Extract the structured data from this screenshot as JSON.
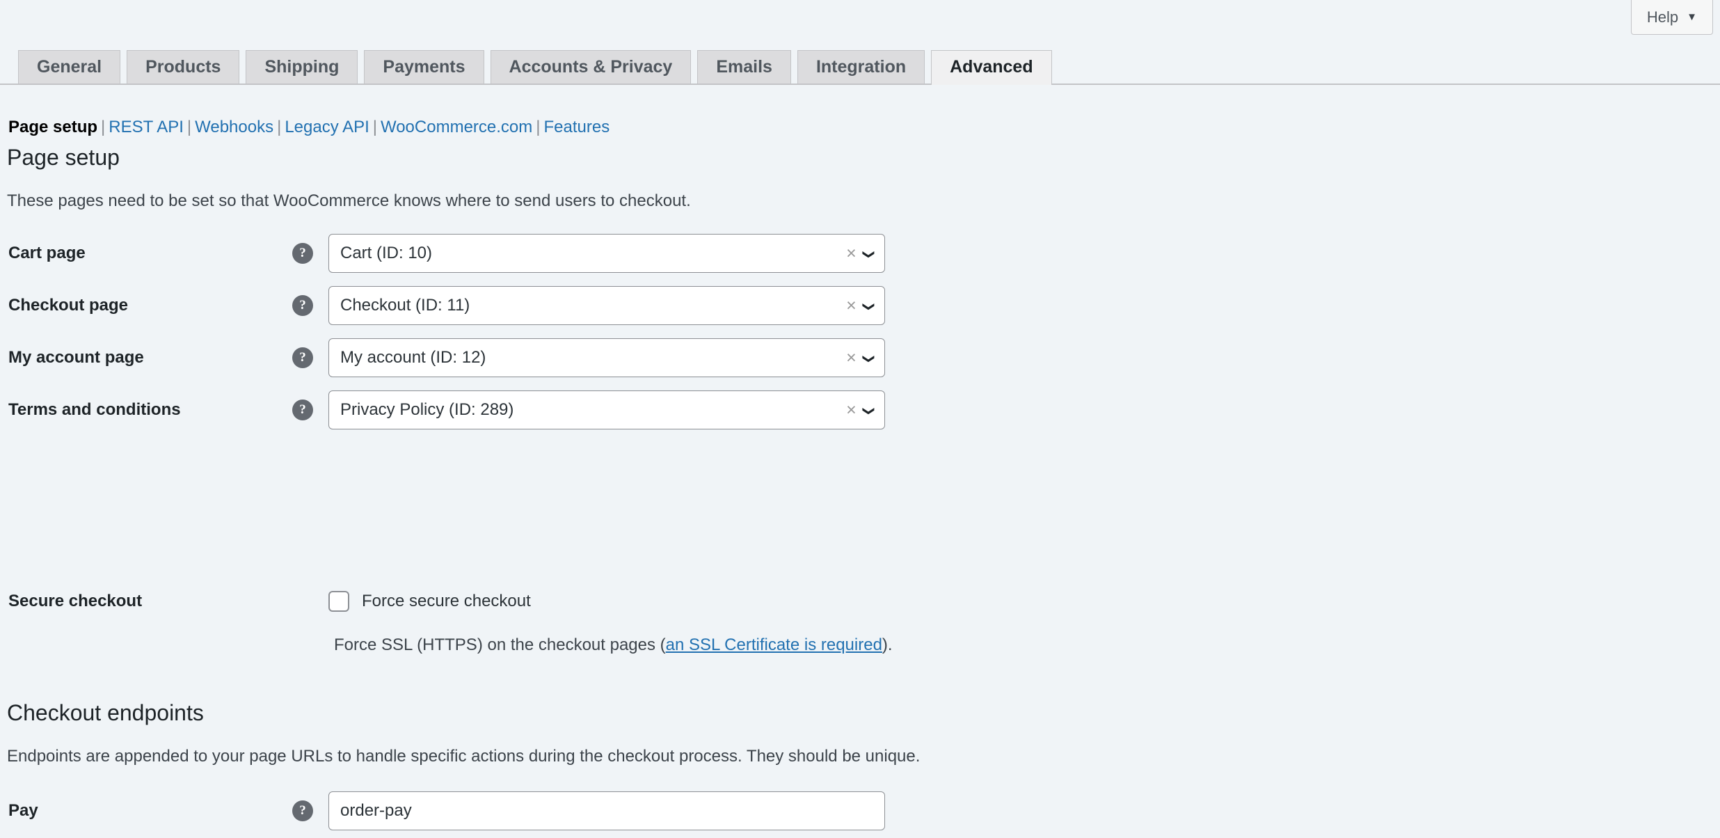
{
  "help": {
    "label": "Help",
    "caret": "chevron-down-icon"
  },
  "tabs": [
    {
      "label": "General",
      "active": false
    },
    {
      "label": "Products",
      "active": false
    },
    {
      "label": "Shipping",
      "active": false
    },
    {
      "label": "Payments",
      "active": false
    },
    {
      "label": "Accounts & Privacy",
      "active": false
    },
    {
      "label": "Emails",
      "active": false
    },
    {
      "label": "Integration",
      "active": false
    },
    {
      "label": "Advanced",
      "active": true
    }
  ],
  "subnav": {
    "current": "Page setup",
    "links": [
      "REST API",
      "Webhooks",
      "Legacy API",
      "WooCommerce.com",
      "Features"
    ],
    "separator": "|"
  },
  "page_setup": {
    "title": "Page setup",
    "description": "These pages need to be set so that WooCommerce knows where to send users to checkout.",
    "rows": [
      {
        "label": "Cart page",
        "value": "Cart (ID: 10)",
        "help": "?",
        "clear": "×",
        "caret": "⌄"
      },
      {
        "label": "Checkout page",
        "value": "Checkout (ID: 11)",
        "help": "?",
        "clear": "×",
        "caret": "⌄"
      },
      {
        "label": "My account page",
        "value": "My account (ID: 12)",
        "help": "?",
        "clear": "×",
        "caret": "⌄"
      },
      {
        "label": "Terms and conditions",
        "value": "Privacy Policy (ID: 289)",
        "help": "?",
        "clear": "×",
        "caret": "⌄"
      }
    ]
  },
  "secure_checkout": {
    "label": "Secure checkout",
    "checkbox_label": "Force secure checkout",
    "checked": false,
    "note_prefix": "Force SSL (HTTPS) on the checkout pages (",
    "note_link": "an SSL Certificate is required",
    "note_suffix": ")."
  },
  "checkout_endpoints": {
    "title": "Checkout endpoints",
    "description": "Endpoints are appended to your page URLs to handle specific actions during the checkout process. They should be unique.",
    "rows": [
      {
        "label": "Pay",
        "value": "order-pay",
        "help": "?"
      }
    ]
  },
  "colors": {
    "page_background": "#f0f4f7",
    "link": "#2271b1",
    "tab_inactive": "#dcdcde",
    "tab_active": "#f0f0f1",
    "border": "#8c8f94",
    "help_tip": "#646970"
  }
}
